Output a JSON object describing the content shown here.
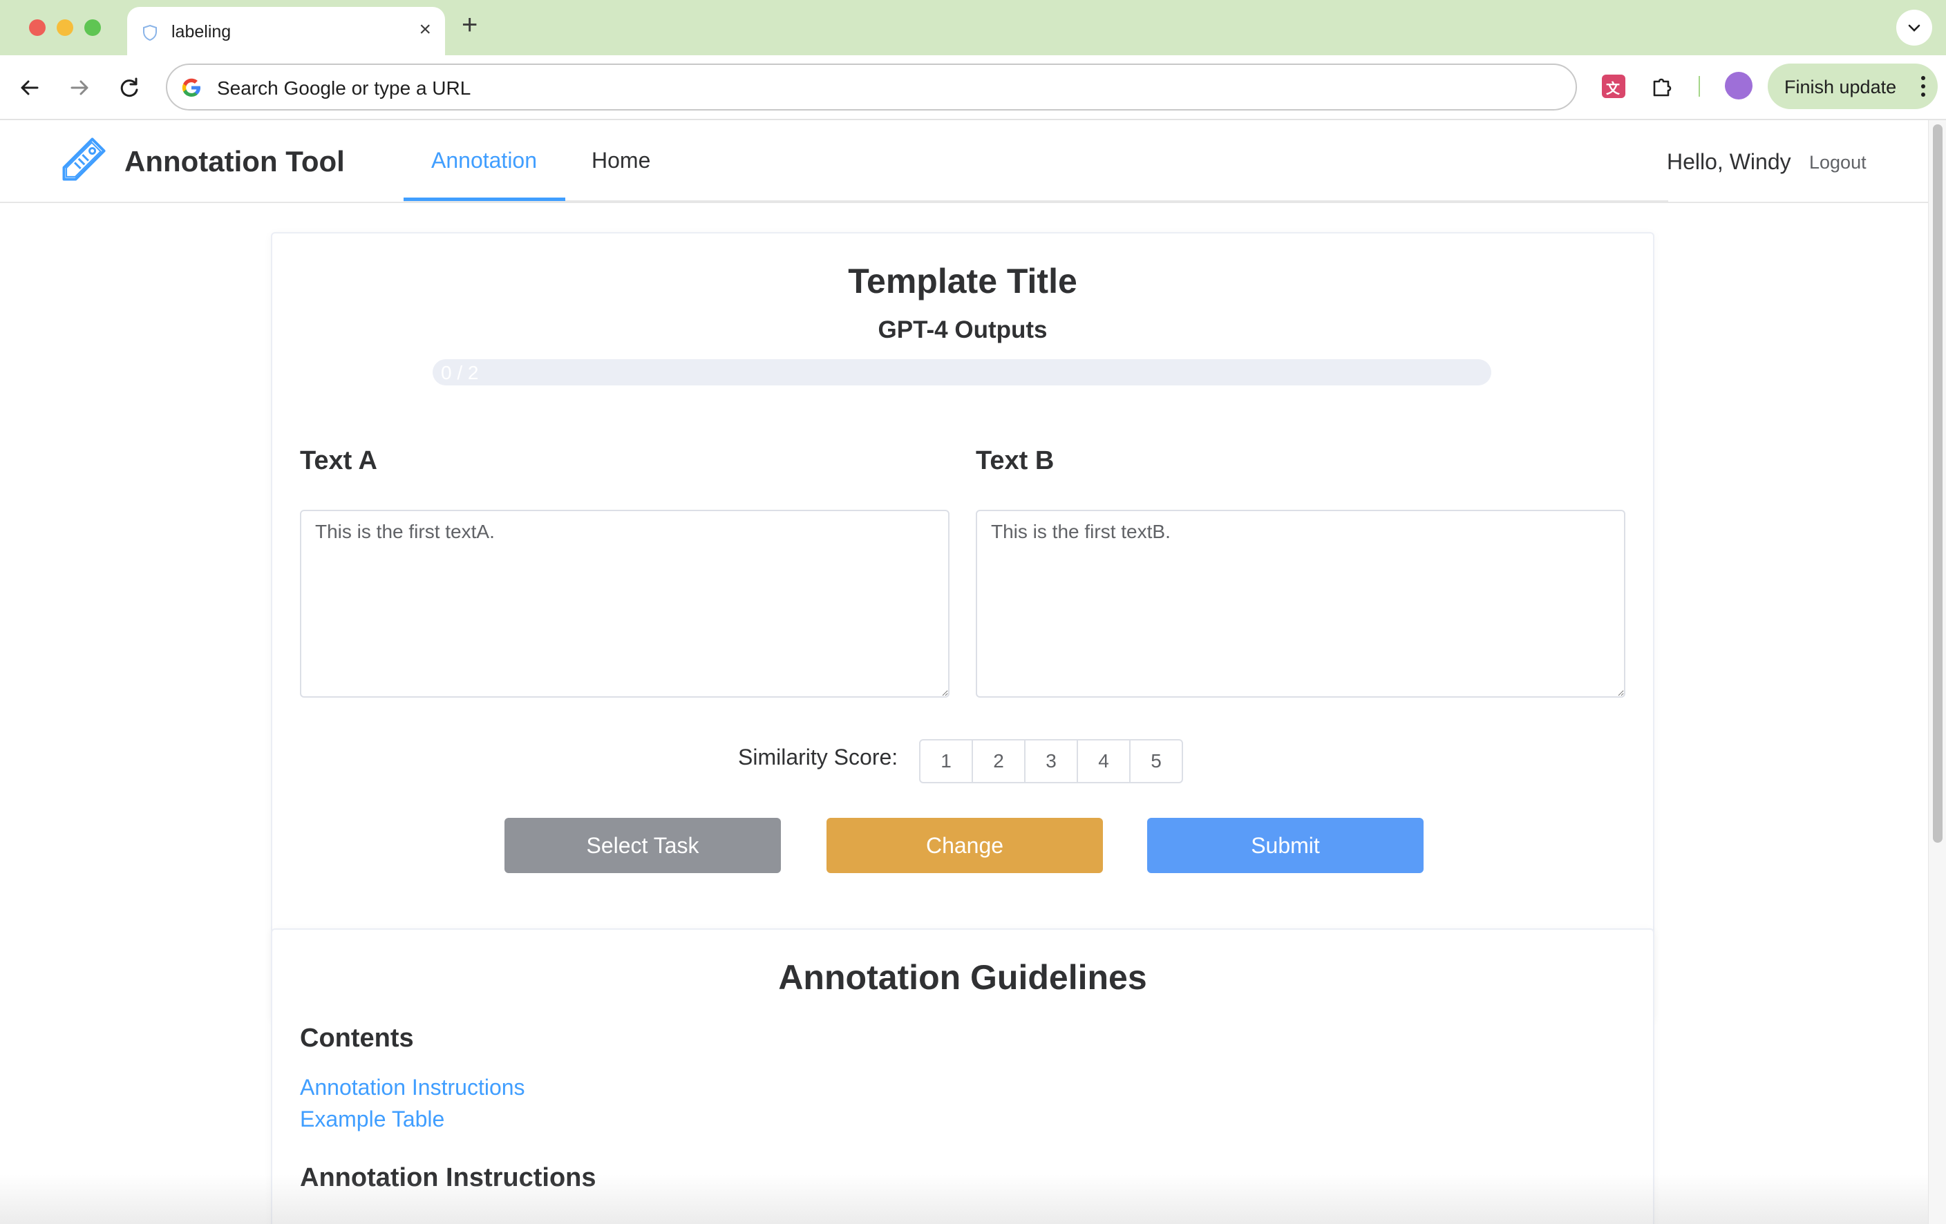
{
  "browser": {
    "tab_title": "labeling",
    "new_tab": "+",
    "close": "×",
    "omnibox_text": "Search Google or type a URL",
    "finish_update": "Finish update",
    "ext_badge": "文A"
  },
  "app": {
    "name": "Annotation Tool",
    "nav": {
      "annotation": "Annotation",
      "home": "Home"
    },
    "greeting": "Hello, Windy",
    "logout": "Logout"
  },
  "task": {
    "title": "Template Title",
    "subtitle": "GPT-4 Outputs",
    "progress_text": "0 / 2",
    "progress_value": 0,
    "text_a_label": "Text A",
    "text_b_label": "Text B",
    "text_a": "This is the first textA.",
    "text_b": "This is the first textB.",
    "score_label": "Similarity Score:",
    "scores": [
      "1",
      "2",
      "3",
      "4",
      "5"
    ],
    "buttons": {
      "select": "Select Task",
      "change": "Change",
      "submit": "Submit"
    }
  },
  "guidelines": {
    "title": "Annotation Guidelines",
    "contents_heading": "Contents",
    "links": [
      "Annotation Instructions",
      "Example Table"
    ],
    "instructions_heading": "Annotation Instructions"
  },
  "colors": {
    "accent": "#409eff",
    "tabbar": "#d3e8c4",
    "change": "#e0a648",
    "select": "#909399",
    "submit": "#5a9cf8"
  }
}
